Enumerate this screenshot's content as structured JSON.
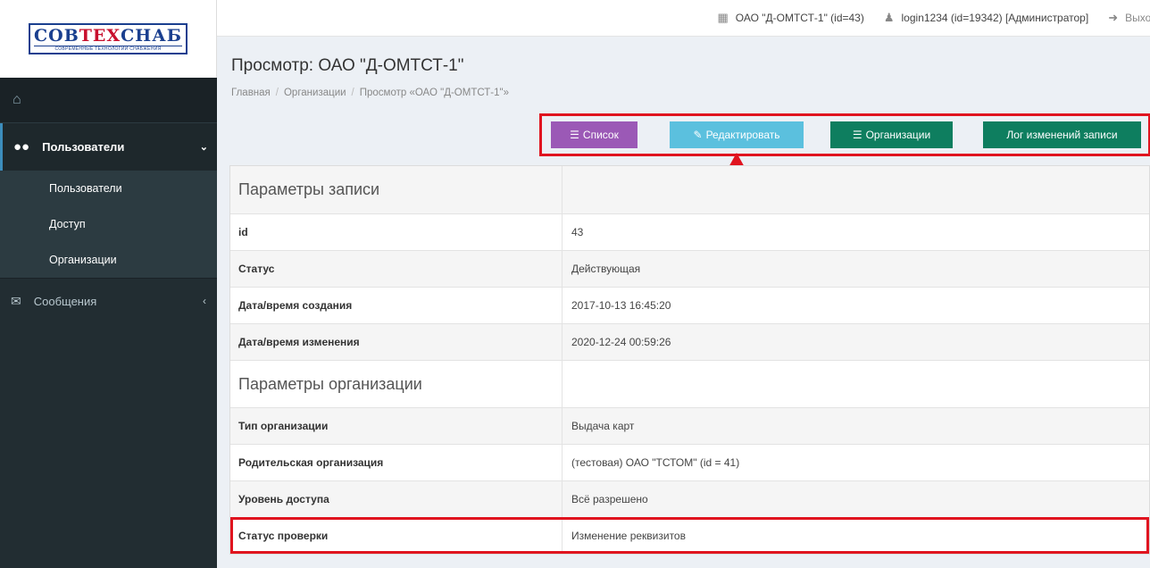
{
  "logo": {
    "main_a": "СОВ",
    "main_b": "ТЕХ",
    "main_c": "СНАБ",
    "sub": "СОВРЕМЕННЫЕ ТЕХНОЛОГИИ СНАБЖЕНИЯ"
  },
  "sidebar": {
    "home_icon": "home-icon",
    "users_group": {
      "label": "Пользователи",
      "icon": "users-icon"
    },
    "items": [
      {
        "label": "Пользователи"
      },
      {
        "label": "Доступ"
      },
      {
        "label": "Организации"
      }
    ],
    "messages": {
      "label": "Сообщения",
      "icon": "envelope-icon"
    }
  },
  "topbar": {
    "org": "ОАО \"Д-ОМТСТ-1\" (id=43)",
    "user": "login1234 (id=19342) [Администратор]",
    "logout": "Выход"
  },
  "page": {
    "title": "Просмотр: ОАО \"Д-ОМТСТ-1\"",
    "breadcrumb": [
      "Главная",
      "Организации",
      "Просмотр «ОАО \"Д-ОМТСТ-1\"»"
    ]
  },
  "buttons": {
    "list": "Список",
    "edit": "Редактировать",
    "orgs": "Организации",
    "log": "Лог изменений записи"
  },
  "table": {
    "section1": "Параметры записи",
    "id_label": "id",
    "id_value": "43",
    "status_label": "Статус",
    "status_value": "Действующая",
    "created_label": "Дата/время создания",
    "created_value": "2017-10-13 16:45:20",
    "modified_label": "Дата/время изменения",
    "modified_value": "2020-12-24 00:59:26",
    "section2": "Параметры организации",
    "type_label": "Тип организации",
    "type_value": "Выдача карт",
    "parent_label": "Родительская организация",
    "parent_value": "(тестовая) ОАО \"ТСТОМ\" (id = 41)",
    "access_label": "Уровень доступа",
    "access_value": "Всё разрешено",
    "check_label": "Статус проверки",
    "check_value": "Изменение реквизитов"
  },
  "colors": {
    "accent": "#3c8dbc",
    "highlight": "#e0141f",
    "purple": "#9b59b6",
    "cyan": "#5bc0de",
    "green": "#0e7e5f"
  }
}
